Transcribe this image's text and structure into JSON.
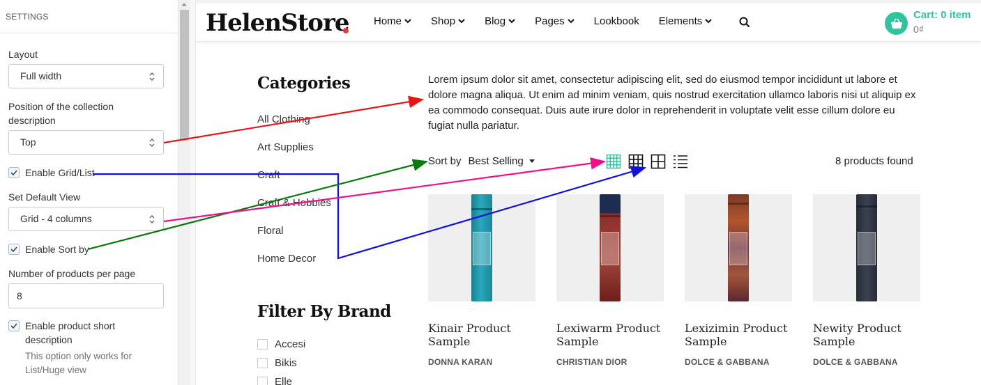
{
  "settings": {
    "heading": "SETTINGS",
    "layout_label": "Layout",
    "layout_value": "Full width",
    "position_label": "Position of the collection description",
    "position_value": "Top",
    "enable_grid_list": "Enable Grid/List",
    "default_view_label": "Set Default View",
    "default_view_value": "Grid - 4 columns",
    "enable_sort_by": "Enable Sort by",
    "products_per_page_label": "Number of products per page",
    "products_per_page_value": "8",
    "enable_short_desc": "Enable product short description",
    "short_desc_note": "This option only works for List/Huge view"
  },
  "header": {
    "logo": "HelenStore",
    "nav": [
      {
        "label": "Home",
        "dropdown": true
      },
      {
        "label": "Shop",
        "dropdown": true
      },
      {
        "label": "Blog",
        "dropdown": true
      },
      {
        "label": "Pages",
        "dropdown": true
      },
      {
        "label": "Lookbook",
        "dropdown": false
      },
      {
        "label": "Elements",
        "dropdown": true
      }
    ],
    "cart_label": "Cart: 0 item",
    "cart_total": "0₫"
  },
  "sidebar": {
    "categories_title": "Categories",
    "categories": [
      "All Clothing",
      "Art Supplies",
      "Craft",
      "Craft & Hobbies",
      "Floral",
      "Home Decor"
    ],
    "brand_title": "Filter By Brand",
    "brands": [
      "Accesi",
      "Bikis",
      "Elle"
    ]
  },
  "collection": {
    "description": "Lorem ipsum dolor sit amet, consectetur adipiscing elit, sed do eiusmod tempor incididunt ut labore et dolore magna aliqua. Ut enim ad minim veniam, quis nostrud exercitation ullamco laboris nisi ut aliquip ex ea commodo consequat. Duis aute irure dolor in reprehenderit in voluptate velit esse cillum dolore eu fugiat nulla pariatur.",
    "sort_label": "Sort by",
    "sort_value": "Best Selling",
    "products_found": "8 products found",
    "view_icons": [
      "grid-4-columns-icon",
      "grid-3-columns-icon",
      "grid-2-columns-icon",
      "list-view-icon"
    ]
  },
  "products": [
    {
      "name": "Kinair Product Sample",
      "brand": "DONNA KARAN",
      "color": "#2196a8"
    },
    {
      "name": "Lexiwarm Product Sample",
      "brand": "CHRISTIAN DIOR",
      "color": "#8a2e2a"
    },
    {
      "name": "Lexizimin Product Sample",
      "brand": "DOLCE & GABBANA",
      "color": "#8c3a2c"
    },
    {
      "name": "Newity Product Sample",
      "brand": "DOLCE & GABBANA",
      "color": "#2d3340"
    }
  ],
  "colors": {
    "accent": "#2ec4a0",
    "arrow_red": "#e8141a",
    "arrow_blue": "#1010e0",
    "arrow_green": "#0a7a0a",
    "arrow_pink": "#ee1088"
  }
}
